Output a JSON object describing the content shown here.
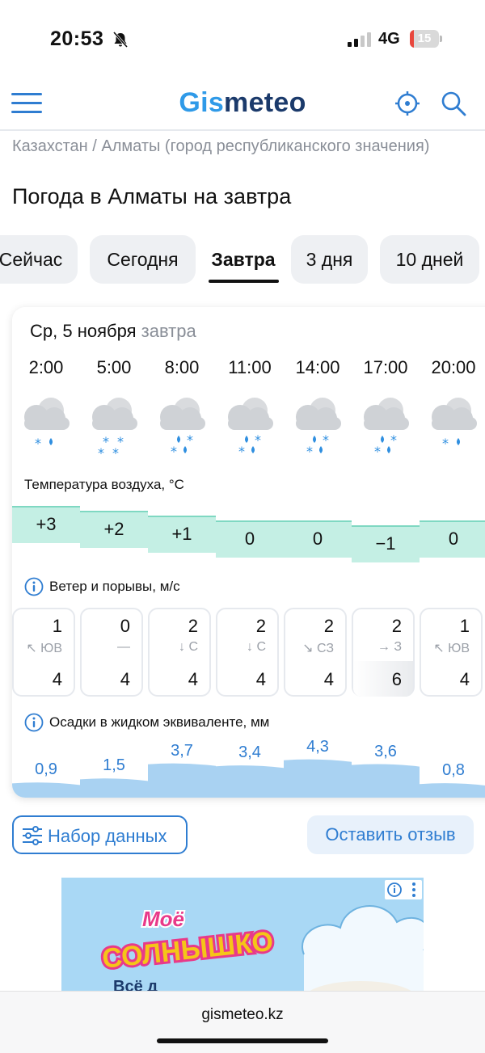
{
  "status_bar": {
    "time": "20:53",
    "network": "4G",
    "battery": "15",
    "battery_level": 0.15
  },
  "header": {
    "logo_part1": "Gis",
    "logo_part2": "meteo"
  },
  "breadcrumb": "Казахстан / Алматы (город республиканского значения)",
  "page_title": "Погода в Алматы на завтра",
  "tabs": [
    {
      "label": "Сейчас",
      "active": false
    },
    {
      "label": "Сегодня",
      "active": false
    },
    {
      "label": "Завтра",
      "active": true
    },
    {
      "label": "3 дня",
      "active": false
    },
    {
      "label": "10 дней",
      "active": false
    }
  ],
  "forecast": {
    "date": "Ср, 5 ноября",
    "date_sub": "завтра",
    "times": [
      "2:00",
      "5:00",
      "8:00",
      "11:00",
      "14:00",
      "17:00",
      "20:00"
    ],
    "weather_icons": [
      "cloud-snow-rain-icon",
      "cloud-heavy-snow-icon",
      "cloud-snow-rain-icon",
      "cloud-snow-rain-icon",
      "cloud-snow-rain-icon",
      "cloud-snow-rain-icon",
      "cloud-snow-rain-icon"
    ],
    "temperature_label": "Температура воздуха, °C",
    "temperatures": [
      "+3",
      "+2",
      "+1",
      "0",
      "0",
      "−1",
      "0"
    ],
    "temperature_values": [
      3,
      2,
      1,
      0,
      0,
      -1,
      0
    ],
    "wind_label": "Ветер и порывы, м/с",
    "wind": [
      {
        "speed": "1",
        "dir": "↖ ЮВ",
        "gust": "4"
      },
      {
        "speed": "0",
        "dir": "—",
        "gust": "4"
      },
      {
        "speed": "2",
        "dir": "↓ С",
        "gust": "4"
      },
      {
        "speed": "2",
        "dir": "↓ С",
        "gust": "4"
      },
      {
        "speed": "2",
        "dir": "↘ СЗ",
        "gust": "4"
      },
      {
        "speed": "2",
        "dir": "→ З",
        "gust": "6"
      },
      {
        "speed": "1",
        "dir": "↖ ЮВ",
        "gust": "4"
      }
    ],
    "precip_label": "Осадки в жидком эквиваленте, мм",
    "precipitation": [
      "0,9",
      "1,5",
      "3,7",
      "3,4",
      "4,3",
      "3,6",
      "0,8"
    ],
    "precipitation_values": [
      0.9,
      1.5,
      3.7,
      3.4,
      4.3,
      3.6,
      0.8
    ]
  },
  "buttons": {
    "data_set": "Набор данных",
    "feedback": "Оставить отзыв"
  },
  "ad": {
    "brand_line1": "Моё",
    "brand_line2": "СОЛНЫШКО",
    "text": "Всё д"
  },
  "url_bar": {
    "url": "gismeteo.kz"
  },
  "colors": {
    "accent": "#2f7dd1",
    "logo_blue": "#2f9ae8",
    "logo_dark": "#1b3a6b",
    "temp_fill": "#c4efe4",
    "precip_fill": "#a9d2f2"
  }
}
